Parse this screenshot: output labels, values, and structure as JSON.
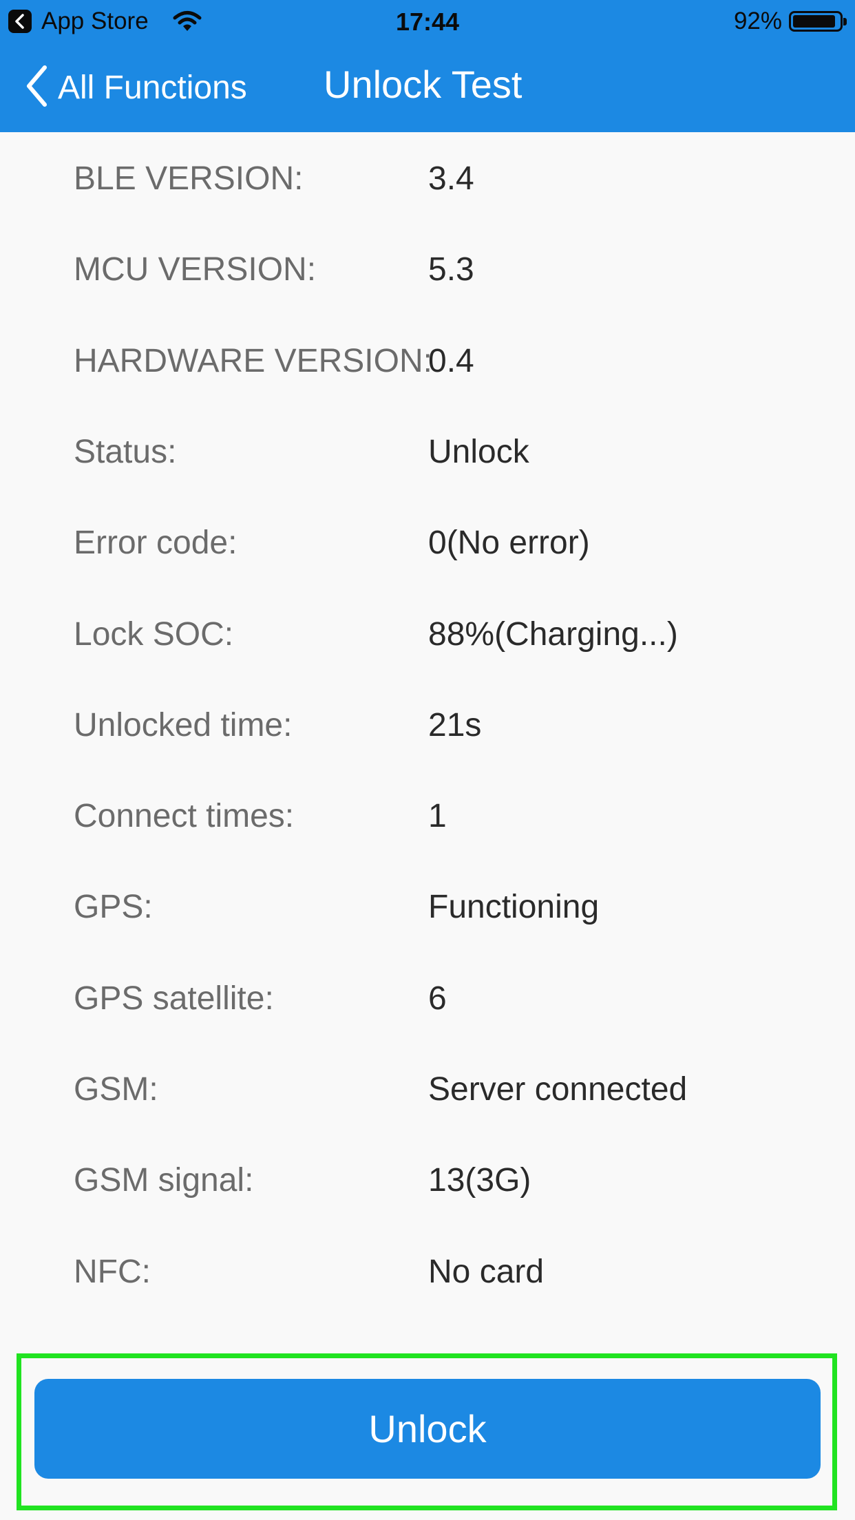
{
  "status_bar": {
    "back_app": "App Store",
    "time": "17:44",
    "battery_percent": "92%",
    "battery_level": 0.92
  },
  "nav": {
    "back_label": "All Functions",
    "title": "Unlock Test"
  },
  "info": [
    {
      "label": "BLE VERSION:",
      "value": "3.4"
    },
    {
      "label": "MCU VERSION:",
      "value": "5.3"
    },
    {
      "label": "HARDWARE VERSION:",
      "value": "0.4"
    },
    {
      "label": "Status:",
      "value": "Unlock"
    },
    {
      "label": "Error code:",
      "value": "0(No error)"
    },
    {
      "label": "Lock SOC:",
      "value": "88%(Charging...)"
    },
    {
      "label": "Unlocked time:",
      "value": "21s"
    },
    {
      "label": "Connect times:",
      "value": "1"
    },
    {
      "label": "GPS:",
      "value": "Functioning"
    },
    {
      "label": "GPS satellite:",
      "value": "6"
    },
    {
      "label": "GSM:",
      "value": "Server connected"
    },
    {
      "label": "GSM signal:",
      "value": "13(3G)"
    },
    {
      "label": "NFC:",
      "value": "No card"
    }
  ],
  "action": {
    "unlock_label": "Unlock"
  },
  "colors": {
    "accent": "#1c89e3",
    "highlight": "#21e321",
    "background": "#f9f9f9"
  },
  "icons": [
    "back-app-icon",
    "wifi-icon",
    "battery-icon",
    "chevron-left-icon"
  ]
}
